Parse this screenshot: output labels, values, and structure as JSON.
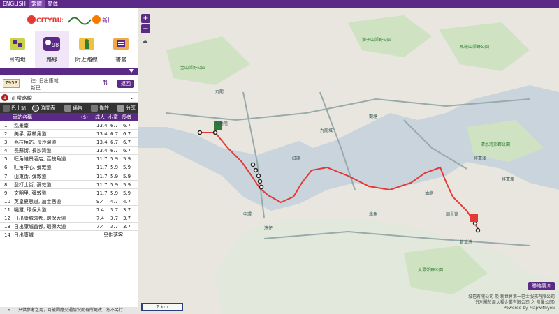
{
  "languages": [
    "ENGLISH",
    "繁體",
    "簡体"
  ],
  "active_language": "繁體",
  "brands": {
    "citybus": "CITYBUS城巴",
    "nwfb": "新巴"
  },
  "modes": [
    {
      "label": "目的地",
      "icon": "destination-icon"
    },
    {
      "label": "路線",
      "icon": "route-icon",
      "number": "98"
    },
    {
      "label": "附近路線",
      "icon": "nearby-route-icon"
    },
    {
      "label": "書籤",
      "icon": "bookmark-icon"
    }
  ],
  "route": {
    "number": "795P",
    "destination": "往: 日出康城",
    "operator": "新巴",
    "back_label": "返回"
  },
  "direction": {
    "num": "1",
    "label": "正常路線"
  },
  "toolbar": [
    {
      "label": "巴士站",
      "icon": "bus-stop-icon"
    },
    {
      "label": "時間表",
      "icon": "timetable-icon"
    },
    {
      "label": "通告",
      "icon": "notice-icon"
    },
    {
      "label": "備註",
      "icon": "remark-icon"
    },
    {
      "label": "分享",
      "icon": "share-icon"
    }
  ],
  "table_header": {
    "name": "車站名稱",
    "fare": "($)",
    "adult": "成人",
    "child": "小童",
    "elder": "長者"
  },
  "stops": [
    {
      "no": "1",
      "name": "泓景臺",
      "fare": "13.4",
      "child": "6.7",
      "elder": "6.7"
    },
    {
      "no": "2",
      "name": "美孚, 荔枝角道",
      "fare": "13.4",
      "child": "6.7",
      "elder": "6.7"
    },
    {
      "no": "3",
      "name": "荔枝角站, 長沙灣道",
      "fare": "13.4",
      "child": "6.7",
      "elder": "6.7"
    },
    {
      "no": "4",
      "name": "長蘇街, 長沙灣道",
      "fare": "13.4",
      "child": "6.7",
      "elder": "6.7"
    },
    {
      "no": "5",
      "name": "旺角維景酒店, 荔枝角道",
      "fare": "11.7",
      "child": "5.9",
      "elder": "5.9"
    },
    {
      "no": "6",
      "name": "旺角中心, 彌敦道",
      "fare": "11.7",
      "child": "5.9",
      "elder": "5.9"
    },
    {
      "no": "7",
      "name": "山東街, 彌敦道",
      "fare": "11.7",
      "child": "5.9",
      "elder": "5.9"
    },
    {
      "no": "8",
      "name": "登打士街, 彌敦道",
      "fare": "11.7",
      "child": "5.9",
      "elder": "5.9"
    },
    {
      "no": "9",
      "name": "文明里, 彌敦道",
      "fare": "11.7",
      "child": "5.9",
      "elder": "5.9"
    },
    {
      "no": "10",
      "name": "英皇夏慤道, 加士居道",
      "fare": "9.4",
      "child": "4.7",
      "elder": "4.7"
    },
    {
      "no": "11",
      "name": "曉璽, 環保大道",
      "fare": "7.4",
      "child": "3.7",
      "elder": "3.7"
    },
    {
      "no": "12",
      "name": "日出康城領都, 環保大道",
      "fare": "7.4",
      "child": "3.7",
      "elder": "3.7"
    },
    {
      "no": "13",
      "name": "日出康城首都, 環保大道",
      "fare": "7.4",
      "child": "3.7",
      "elder": "3.7"
    },
    {
      "no": "14",
      "name": "日出康城",
      "fare": "",
      "child": "",
      "elder": "",
      "note": "只供落客"
    }
  ],
  "disclaimer": "只供參考之用，可能因應交通情況而有所更改，恕不另行",
  "map": {
    "zoom_in": "+",
    "zoom_out": "−",
    "scale_label": "2 km",
    "about_label": "聯絡廣介",
    "copyright1": "城巴有限公司 及 新世界第一巴士服務有限公司",
    "copyright2": "(分別屬於周大福企業有限公司 之 附屬公司)",
    "copyright3": "Powered by Mapwithyou",
    "labels": [
      {
        "t": "九龍",
        "green": false
      },
      {
        "t": "大角咀",
        "green": false
      },
      {
        "t": "紅磡",
        "green": false
      },
      {
        "t": "九龍城",
        "green": false
      },
      {
        "t": "將軍澳",
        "green": false
      },
      {
        "t": "調景嶺",
        "green": false
      },
      {
        "t": "油塘",
        "green": false
      },
      {
        "t": "觀塘",
        "green": false
      },
      {
        "t": "筲箕灣",
        "green": false
      },
      {
        "t": "北角",
        "green": false
      },
      {
        "t": "灣仔",
        "green": false
      },
      {
        "t": "中環",
        "green": false
      },
      {
        "t": "獅子山郊野公園",
        "green": true
      },
      {
        "t": "馬鞍山郊野公園",
        "green": true
      },
      {
        "t": "金山郊野公園",
        "green": true
      },
      {
        "t": "大潭郊野公園",
        "green": true
      },
      {
        "t": "清水灣郊野公園",
        "green": true
      },
      {
        "t": "將軍澳",
        "green": false
      }
    ]
  }
}
